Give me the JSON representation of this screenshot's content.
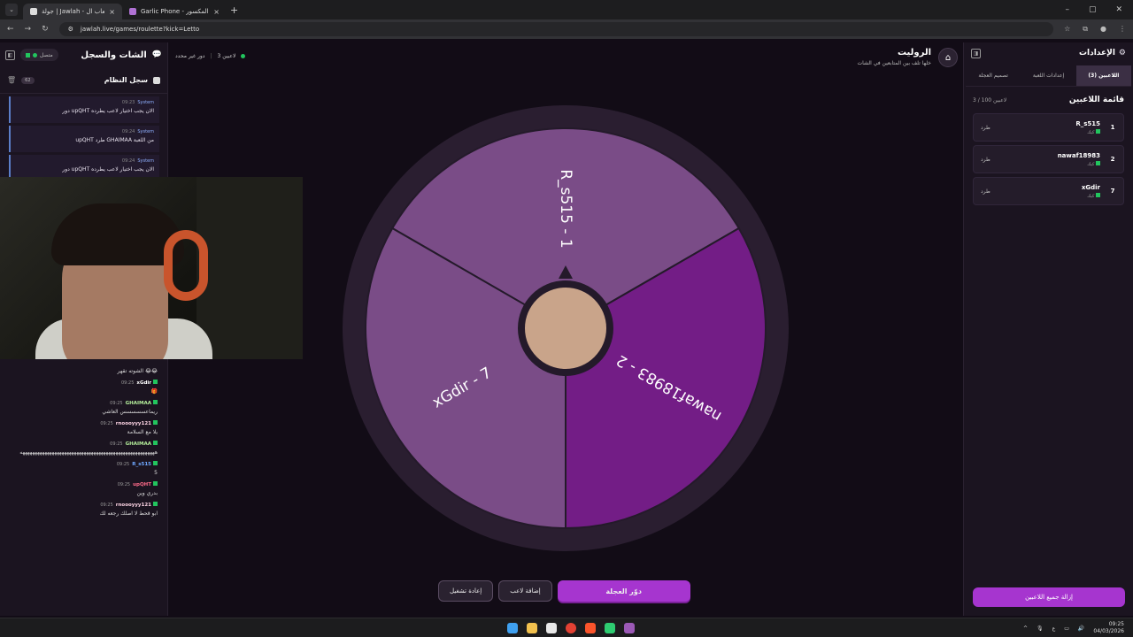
{
  "browser": {
    "tabs": [
      {
        "label": "جولة | Jawlah - منصة الألعاب ال...",
        "active": true
      },
      {
        "label": "Garlic Phone - الهاتف المكسور -",
        "active": false
      }
    ],
    "url": "jawlah.live/games/roulette?kick=Letto"
  },
  "left": {
    "title": "الشات والسجل",
    "status": "متصل",
    "system_log": {
      "label": "سجل النظام",
      "count": "62",
      "messages": [
        {
          "sender": "System",
          "time": "09:23",
          "text": "دور upQHT الان يجب اختيار لاعب يطرده"
        },
        {
          "sender": "System",
          "time": "09:24",
          "text": "upQHT طرد GHAIMAA من اللعبة"
        },
        {
          "sender": "System",
          "time": "09:24",
          "text": "دور upQHT الان يجب اختيار لاعب يطرده"
        }
      ]
    },
    "chat": [
      {
        "user": "",
        "time": "",
        "text": "الشوته تقهر 😂😂",
        "color": "#dddddd"
      },
      {
        "user": "xGdir",
        "time": "09:25",
        "text": "🎁",
        "color": "#ffffff"
      },
      {
        "user": "GHAIMAA",
        "time": "09:25",
        "text": "ريماعسسسسس العاشي",
        "color": "#b6f09c"
      },
      {
        "user": "rnoooyyy121",
        "time": "09:25",
        "text": "يلا مع السلامة",
        "color": "#ffd6e6"
      },
      {
        "user": "GHAIMAA",
        "time": "09:25",
        "text": "هههههههههههههههههههههههههههههههههههههههههههههههههههههههه",
        "color": "#b6f09c"
      },
      {
        "user": "R_s515",
        "time": "09:25",
        "text": "5",
        "color": "#6fa8ff"
      },
      {
        "user": "upQHT",
        "time": "09:25",
        "text": "بدري وين",
        "color": "#ff6b8a"
      },
      {
        "user": "rnoooyyy121",
        "time": "09:25",
        "text": "ابو قحط لا اصلك رجعه لك",
        "color": "#ffd6e6"
      }
    ]
  },
  "center": {
    "players_label": "3 لاعبين",
    "round_label": "دور غير محدد",
    "title": "الروليت",
    "subtitle": "خلها تلف بين المتابعين في الشات",
    "buttons": {
      "spin": "دوّر العجلة",
      "add": "إضافة لاعب",
      "restart": "إعادة تشغيل"
    }
  },
  "wheel": {
    "segments": [
      {
        "label": "R_s515 - 1",
        "color": "#7a4c87"
      },
      {
        "label": "nawaf18983 - 2",
        "color": "#731d86"
      },
      {
        "label": "xGdir - 7",
        "color": "#7a4c87"
      }
    ]
  },
  "right": {
    "title": "الإعدادات",
    "tabs": [
      "اللاعبين (3)",
      "إعدادات اللعبة",
      "تصميم العجلة"
    ],
    "list_title": "قائمة اللاعبين",
    "list_count": "3 / 100 لاعبين",
    "kick_label": "طرد",
    "players": [
      {
        "num": "1",
        "name": "R_s515",
        "sub": "كيك"
      },
      {
        "num": "2",
        "name": "nawaf18983",
        "sub": "كيك"
      },
      {
        "num": "7",
        "name": "xGdir",
        "sub": "كيك"
      }
    ],
    "remove_all": "إزالة جميع اللاعبين"
  },
  "taskbar": {
    "time": "09:25",
    "date": "04/03/2026",
    "lang": "ع"
  }
}
